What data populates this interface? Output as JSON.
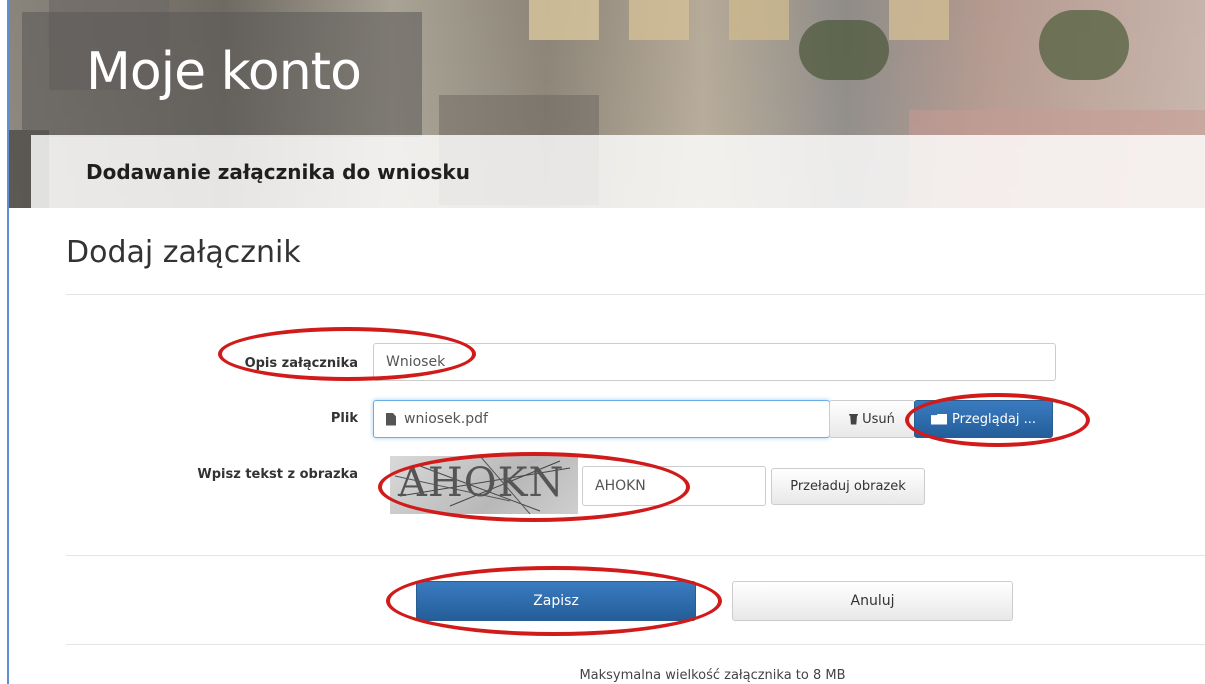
{
  "header": {
    "title": "Moje konto",
    "subtitle": "Dodawanie załącznika do wniosku"
  },
  "main": {
    "heading": "Dodaj załącznik",
    "description": {
      "label": "Opis załącznika",
      "value": "Wniosek"
    },
    "file": {
      "label": "Plik",
      "value": "wniosek.pdf",
      "remove_label": "Usuń",
      "browse_label": "Przeglądaj ..."
    },
    "captcha": {
      "label": "Wpisz tekst z obrazka",
      "image_text": "AHOKN",
      "value": "AHOKN",
      "reload_label": "Przeładuj obrazek"
    },
    "actions": {
      "save_label": "Zapisz",
      "cancel_label": "Anuluj"
    },
    "footnote": "Maksymalna wielkość załącznika to 8 MB"
  },
  "colors": {
    "primary": "#2f6ead",
    "annotation": "#d11a1a",
    "focus": "#66afe9"
  }
}
